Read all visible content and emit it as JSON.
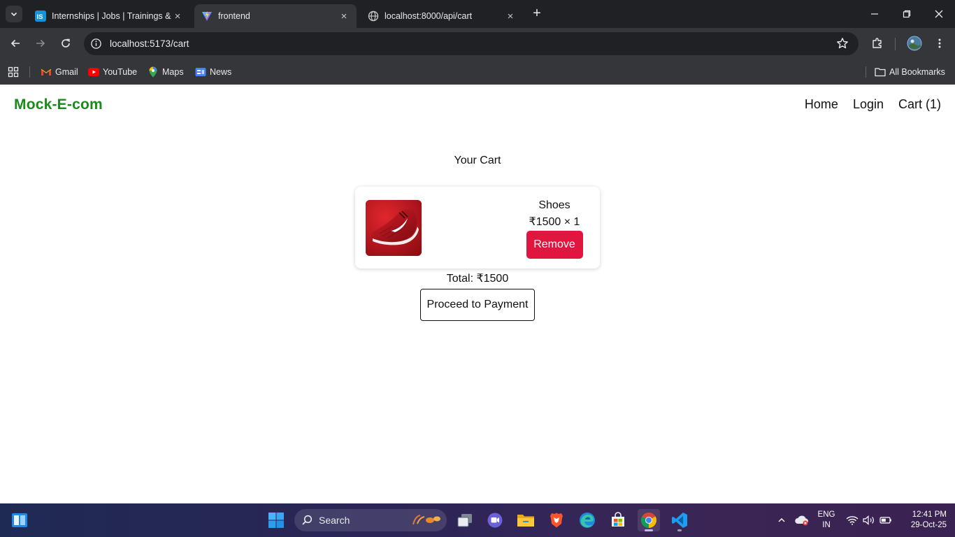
{
  "browser": {
    "tabs": [
      {
        "title": "Internships | Jobs | Trainings & Placements",
        "favicon": "internshala-icon"
      },
      {
        "title": "frontend",
        "favicon": "vite-icon",
        "active": true
      },
      {
        "title": "localhost:8000/api/cart",
        "favicon": "globe-icon"
      }
    ],
    "url": "localhost:5173/cart",
    "bookmarks": [
      {
        "label": "Gmail",
        "icon": "gmail-icon"
      },
      {
        "label": "YouTube",
        "icon": "youtube-icon"
      },
      {
        "label": "Maps",
        "icon": "maps-icon"
      },
      {
        "label": "News",
        "icon": "news-icon"
      }
    ],
    "all_bookmarks_label": "All Bookmarks"
  },
  "app": {
    "brand": "Mock-E-com",
    "nav": {
      "home": "Home",
      "login": "Login",
      "cart": "Cart (1)"
    },
    "brand_color": "#1a8a1a"
  },
  "cart": {
    "heading": "Your Cart",
    "items": [
      {
        "name": "Shoes",
        "price_line": "₹1500 × 1",
        "remove_label": "Remove",
        "image": "red-shoe-image"
      }
    ],
    "total": "Total: ₹1500",
    "proceed_label": "Proceed to Payment",
    "remove_color": "#e0163f"
  },
  "taskbar": {
    "search_label": "Search",
    "language": "ENG",
    "region": "IN",
    "time": "12:41 PM",
    "date": "29-Oct-25"
  }
}
